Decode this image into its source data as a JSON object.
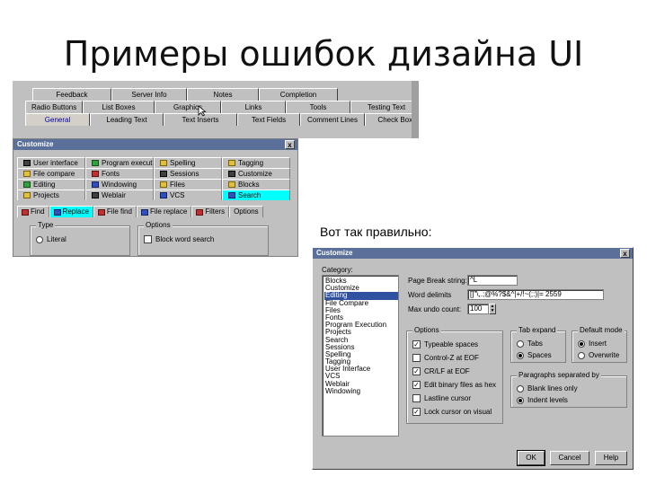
{
  "slide": {
    "title": "Примеры ошибок дизайна UI",
    "caption": "Вот так правильно:"
  },
  "bad_example": {
    "tab_rows": [
      [
        "Feedback",
        "Server Info",
        "Notes",
        "Completion"
      ],
      [
        "Radio Buttons",
        "List Boxes",
        "Graphics",
        "Links",
        "Tools",
        "Testing Text"
      ],
      [
        "General",
        "Leading Text",
        "Text Inserts",
        "Text Fields",
        "Comment Lines",
        "Check Boxes"
      ]
    ],
    "window_title": "Customize",
    "close_label": "x",
    "category_tabs": [
      {
        "label": "User interface",
        "icon": "user-interface-icon"
      },
      {
        "label": "Program execution",
        "icon": "program-execution-icon"
      },
      {
        "label": "Spelling",
        "icon": "spelling-icon"
      },
      {
        "label": "Tagging",
        "icon": "tagging-icon"
      },
      {
        "label": "File compare",
        "icon": "file-compare-icon"
      },
      {
        "label": "Fonts",
        "icon": "fonts-icon"
      },
      {
        "label": "Sessions",
        "icon": "sessions-icon"
      },
      {
        "label": "Customize",
        "icon": "customize-icon"
      },
      {
        "label": "Editing",
        "icon": "editing-icon"
      },
      {
        "label": "Windowing",
        "icon": "windowing-icon"
      },
      {
        "label": "Files",
        "icon": "files-icon"
      },
      {
        "label": "Blocks",
        "icon": "blocks-icon"
      },
      {
        "label": "Projects",
        "icon": "projects-icon"
      },
      {
        "label": "Weblair",
        "icon": "weblair-icon"
      },
      {
        "label": "VCS",
        "icon": "vcs-icon"
      },
      {
        "label": "Search",
        "icon": "search-icon"
      }
    ],
    "sub_tabs": [
      {
        "label": "Find",
        "icon": "find-icon"
      },
      {
        "label": "Replace",
        "icon": "replace-icon"
      },
      {
        "label": "File find",
        "icon": "file-find-icon"
      },
      {
        "label": "File replace",
        "icon": "file-replace-icon"
      },
      {
        "label": "Filters",
        "icon": "filters-icon"
      },
      {
        "label": "Options",
        "icon": ""
      }
    ],
    "type_group_label": "Type",
    "type_option": "Literal",
    "options_group_label": "Options",
    "options_option": "Block word search"
  },
  "good_example": {
    "window_title": "Customize",
    "close_label": "x",
    "category_label": "Category:",
    "categories": [
      "Blocks",
      "Customize",
      "Editing",
      "File Compare",
      "Files",
      "Fonts",
      "Program Execution",
      "Projects",
      "Search",
      "Sessions",
      "Spelling",
      "Tagging",
      "User Interface",
      "VCS",
      "Weblair",
      "Windowing"
    ],
    "selected_category": "Editing",
    "page_break_label": "Page Break string:",
    "page_break_value": "^L",
    "word_delimits_label": "Word delimits",
    "word_delimits_value": "[]\"\\,.;@%?$&^|+/!~(;:)|= 2559",
    "max_undo_label": "Max undo count:",
    "max_undo_value": "100",
    "options_label": "Options",
    "options": [
      {
        "label": "Typeable spaces",
        "checked": true
      },
      {
        "label": "Control-Z at EOF",
        "checked": false
      },
      {
        "label": "CR/LF at EOF",
        "checked": true
      },
      {
        "label": "Edit binary files as hex",
        "checked": true
      },
      {
        "label": "Lastline cursor",
        "checked": false
      },
      {
        "label": "Lock cursor on visual",
        "checked": true
      }
    ],
    "tab_expand_label": "Tab expand",
    "tab_expand_options": [
      {
        "label": "Tabs",
        "selected": false
      },
      {
        "label": "Spaces",
        "selected": true
      }
    ],
    "default_mode_label": "Default mode",
    "default_mode_options": [
      {
        "label": "Insert",
        "selected": true
      },
      {
        "label": "Overwrite",
        "selected": false
      }
    ],
    "paragraphs_label": "Paragraphs separated by",
    "paragraphs_options": [
      {
        "label": "Blank lines only",
        "selected": false
      },
      {
        "label": "Indent levels",
        "selected": true
      }
    ],
    "buttons": {
      "ok": "OK",
      "cancel": "Cancel",
      "help": "Help"
    }
  },
  "colors": {
    "dialog_gray": "#c0c0c0",
    "titlebar": "#5a6f9a",
    "highlight_cyan": "#00ffff",
    "selection": "#3050a0"
  }
}
